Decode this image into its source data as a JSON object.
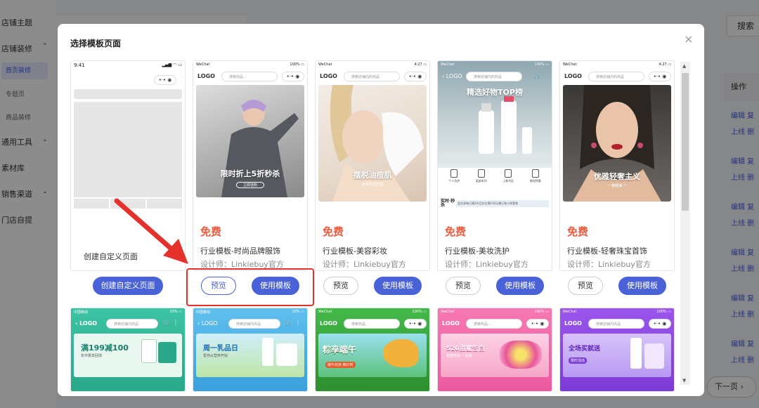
{
  "background": {
    "sidebar": [
      {
        "label": "店铺主题"
      },
      {
        "label": "店铺装修"
      },
      {
        "label": "首页装修"
      },
      {
        "label": "专题页"
      },
      {
        "label": "商品装修"
      },
      {
        "label": "通用工具"
      },
      {
        "label": "素材库"
      },
      {
        "label": "销售渠道"
      },
      {
        "label": "门店自提"
      }
    ],
    "search_button": "搜索",
    "ops_header": "操作",
    "row_actions": [
      "编辑 复",
      "上线 删"
    ],
    "next_page": "下一页"
  },
  "modal": {
    "title": "选择模板页面",
    "close": "×"
  },
  "templates": [
    {
      "custom": true,
      "status_time": "9:41",
      "label": "创建自定义页面",
      "button": "创建自定义页面"
    },
    {
      "price": "免费",
      "name": "行业模板-时尚品牌服饰",
      "designer": "设计师：Linkiebuy官方",
      "status": "WeChat",
      "logo": "LOGO",
      "search_ph": "搜索商品...",
      "hero_text": "限时折上5折秒杀",
      "hero_sub": "立即选购",
      "preview": "预览",
      "use": "使用模板"
    },
    {
      "price": "免费",
      "name": "行业模板-美容彩妆",
      "designer": "设计师：Linkiebuy官方",
      "status": "WeChat",
      "logo": "LOGO",
      "search_ph": "搜索店铺内的商品",
      "hero_text": "摆脱油痘肌",
      "hero_sub": "高效清洁控油",
      "preview": "预览",
      "use": "使用模板"
    },
    {
      "price": "免费",
      "name": "行业模板-美妆洗护",
      "designer": "设计师：Linkiebuy官方",
      "status": "WeChat",
      "logo": "LOGO",
      "search_ph": "搜索店铺内的商品",
      "hero_text": "精选好物TOP榜",
      "cats": [
        "个人洗护",
        "面部系列",
        "上新专区",
        "限时特惠"
      ],
      "banner": "会员享每日满2件且实付满150元赠正装小样套装",
      "preview": "预览",
      "use": "使用模板"
    },
    {
      "price": "免费",
      "name": "行业模板-轻奢珠宝首饰",
      "designer": "设计师：Linkiebuy官方",
      "status": "WeChat",
      "logo": "LOGO",
      "search_ph": "搜索店铺内的商品",
      "hero_text": "优雅轻奢主义",
      "hero_sub": "一 精致美 一",
      "preview": "预览",
      "use": "使用模板"
    }
  ],
  "templates_row2": [
    {
      "logo": "LOGO",
      "search_ph": "搜索店铺内商品",
      "status": "中国移动",
      "hero_text": "满199减100",
      "hero_sub": "年中惠享回馈",
      "color": "#2fb89a"
    },
    {
      "logo": "LOGO",
      "search_ph": "搜索店铺内商品",
      "status": "中国移动",
      "hero_text": "周一乳品日",
      "hero_sub": "爱你从营养开始",
      "color": "#4fb6e8"
    },
    {
      "logo": "LOGO",
      "search_ph": "搜索商品...",
      "status": "WeChat",
      "hero_text": "粽享端午",
      "hero_sub": "端午狂欢·倒计时",
      "color": "#3aa83c"
    },
    {
      "logo": "LOGO",
      "search_ph": "搜索商品...",
      "status": "WeChat",
      "hero_text": "520甜蜜告白",
      "hero_sub": "甜蜜告白 一起来",
      "color": "#f06aa8"
    },
    {
      "logo": "LOGO",
      "search_ph": "搜索店铺内商品",
      "status": "WeChat",
      "hero_text": "全场买就送",
      "hero_sub": "限时活动",
      "color": "#8a45e0"
    }
  ]
}
